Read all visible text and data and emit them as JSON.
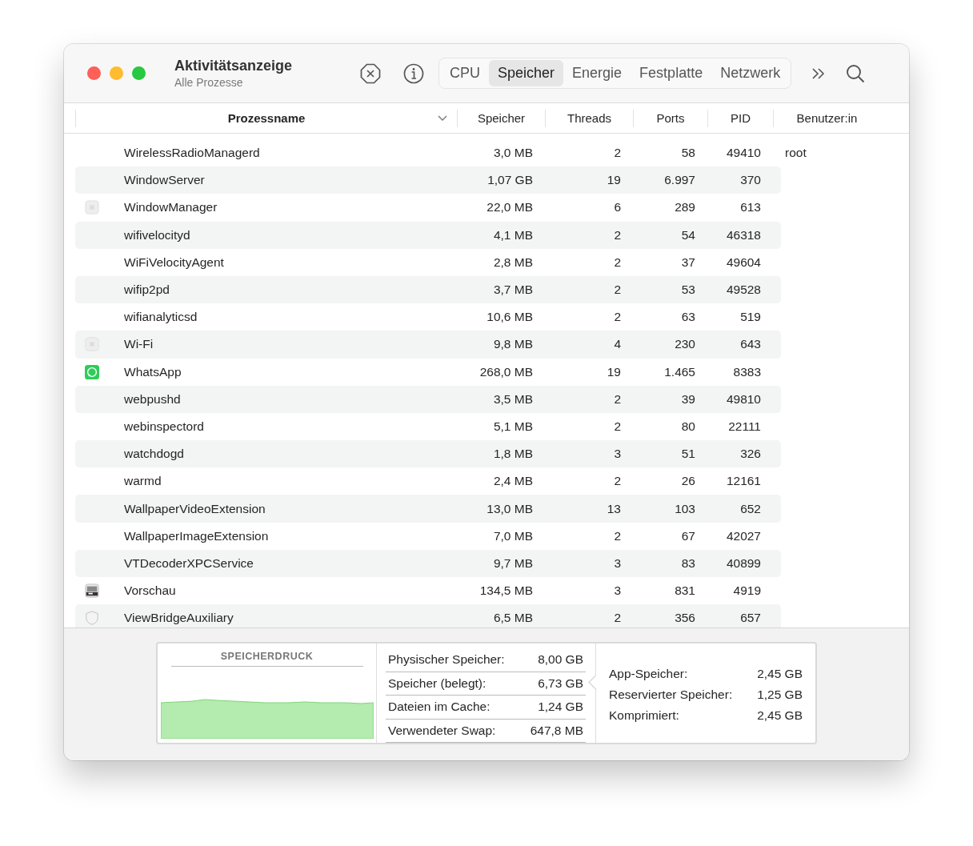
{
  "window": {
    "title": "Aktivitätsanzeige",
    "subtitle": "Alle Prozesse"
  },
  "tabs": [
    {
      "label": "CPU",
      "selected": false
    },
    {
      "label": "Speicher",
      "selected": true
    },
    {
      "label": "Energie",
      "selected": false
    },
    {
      "label": "Festplatte",
      "selected": false
    },
    {
      "label": "Netzwerk",
      "selected": false
    }
  ],
  "table": {
    "columns": [
      "Prozessname",
      "Speicher",
      "Threads",
      "Ports",
      "PID",
      "Benutzer:in"
    ],
    "rows": [
      {
        "kind": "plain",
        "name": "WirelessRadioManagerd",
        "memory": "3,0 MB",
        "threads": "2",
        "ports": "58",
        "pid": "49410",
        "user": "root"
      },
      {
        "kind": "plain",
        "name": "WindowServer",
        "memory": "1,07 GB",
        "threads": "19",
        "ports": "6.997",
        "pid": "370"
      },
      {
        "kind": "app",
        "name": "WindowManager",
        "memory": "22,0 MB",
        "threads": "6",
        "ports": "289",
        "pid": "613"
      },
      {
        "kind": "plain",
        "name": "wifivelocityd",
        "memory": "4,1 MB",
        "threads": "2",
        "ports": "54",
        "pid": "46318"
      },
      {
        "kind": "plain",
        "name": "WiFiVelocityAgent",
        "memory": "2,8 MB",
        "threads": "2",
        "ports": "37",
        "pid": "49604"
      },
      {
        "kind": "plain",
        "name": "wifip2pd",
        "memory": "3,7 MB",
        "threads": "2",
        "ports": "53",
        "pid": "49528"
      },
      {
        "kind": "plain",
        "name": "wifianalyticsd",
        "memory": "10,6 MB",
        "threads": "2",
        "ports": "63",
        "pid": "519"
      },
      {
        "kind": "app",
        "name": "Wi-Fi",
        "memory": "9,8 MB",
        "threads": "4",
        "ports": "230",
        "pid": "643"
      },
      {
        "kind": "chat",
        "name": "WhatsApp",
        "memory": "268,0 MB",
        "threads": "19",
        "ports": "1.465",
        "pid": "8383"
      },
      {
        "kind": "plain",
        "name": "webpushd",
        "memory": "3,5 MB",
        "threads": "2",
        "ports": "39",
        "pid": "49810"
      },
      {
        "kind": "plain",
        "name": "webinspectord",
        "memory": "5,1 MB",
        "threads": "2",
        "ports": "80",
        "pid": "22111"
      },
      {
        "kind": "plain",
        "name": "watchdogd",
        "memory": "1,8 MB",
        "threads": "3",
        "ports": "51",
        "pid": "326"
      },
      {
        "kind": "plain",
        "name": "warmd",
        "memory": "2,4 MB",
        "threads": "2",
        "ports": "26",
        "pid": "12161"
      },
      {
        "kind": "plain",
        "name": "WallpaperVideoExtension",
        "memory": "13,0 MB",
        "threads": "13",
        "ports": "103",
        "pid": "652"
      },
      {
        "kind": "plain",
        "name": "WallpaperImageExtension",
        "memory": "7,0 MB",
        "threads": "2",
        "ports": "67",
        "pid": "42027"
      },
      {
        "kind": "plain",
        "name": "VTDecoderXPCService",
        "memory": "9,7 MB",
        "threads": "3",
        "ports": "83",
        "pid": "40899"
      },
      {
        "kind": "preview",
        "name": "Vorschau",
        "memory": "134,5 MB",
        "threads": "3",
        "ports": "831",
        "pid": "4919"
      },
      {
        "kind": "shield",
        "name": "ViewBridgeAuxiliary",
        "memory": "6,5 MB",
        "threads": "2",
        "ports": "356",
        "pid": "657"
      }
    ]
  },
  "footer": {
    "chart_title": "SPEICHERDRUCK",
    "stats": [
      {
        "label": "Physischer Speicher:",
        "value": "8,00 GB"
      },
      {
        "label": "Speicher (belegt):",
        "value": "6,73 GB"
      },
      {
        "label": "Dateien im Cache:",
        "value": "1,24 GB"
      },
      {
        "label": "Verwendeter Swap:",
        "value": "647,8 MB"
      }
    ],
    "details": [
      {
        "label": "App-Speicher:",
        "value": "2,45 GB"
      },
      {
        "label": "Reservierter Speicher:",
        "value": "1,25 GB"
      },
      {
        "label": "Komprimiert:",
        "value": "2,45 GB"
      }
    ]
  }
}
